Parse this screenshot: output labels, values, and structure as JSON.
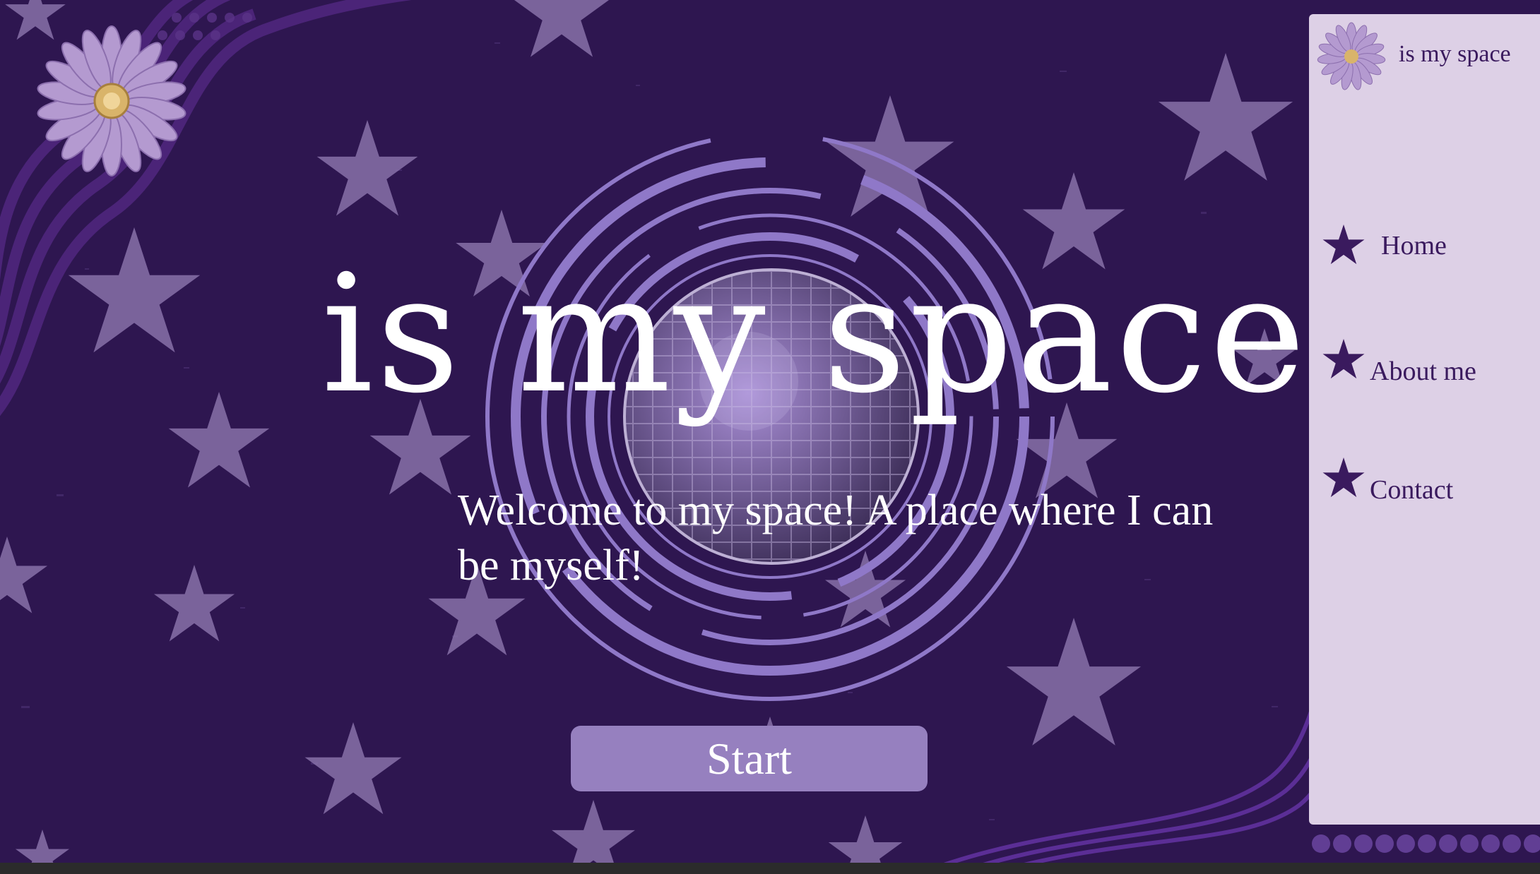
{
  "hero": {
    "title": "is my space",
    "welcome": "Welcome to my space! A place where I can be myself!",
    "start_label": "Start"
  },
  "sidebar": {
    "brand": "is my space",
    "nav": [
      {
        "label": "Home",
        "icon": "star-icon"
      },
      {
        "label": "About me",
        "icon": "star-icon"
      },
      {
        "label": "Contact",
        "icon": "star-icon"
      }
    ]
  },
  "colors": {
    "background": "#2e1650",
    "star": "#8b74ad",
    "ring": "#8f78c8",
    "button": "#9680bf",
    "sidebar": "#ddd0e6",
    "sidebar_text": "#3a1a5e"
  }
}
